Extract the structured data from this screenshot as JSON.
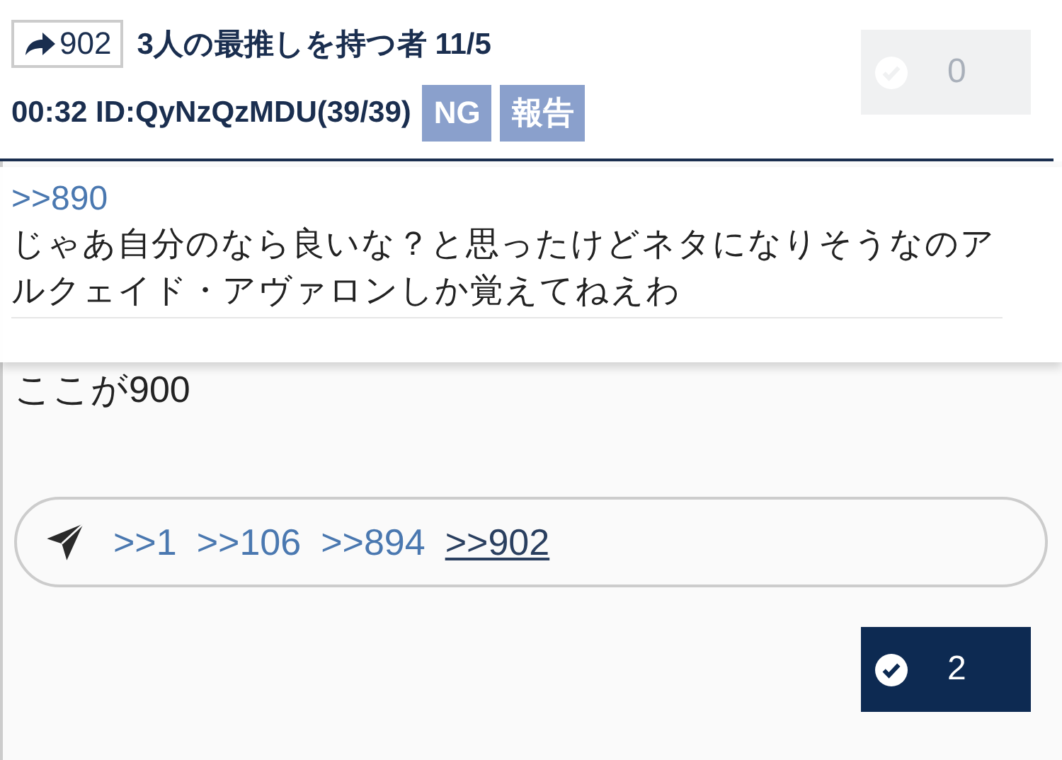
{
  "header": {
    "post_number": "902",
    "name": "3人の最推しを持つ者 11/5",
    "meta": "00:32 ID:QyNzQzMDU(39/39)",
    "tags": [
      "NG",
      "報告"
    ],
    "like": {
      "count": "0",
      "active": false
    }
  },
  "popup": {
    "anchor": ">>890",
    "text": "じゃあ自分のなら良いな？と思ったけどネタになりそうなのアルクェイド・アヴァロンしか覚えてねえわ"
  },
  "post": {
    "body": "ここが900",
    "replies": [
      {
        "label": ">>1",
        "selected": false
      },
      {
        "label": ">>106",
        "selected": false
      },
      {
        "label": ">>894",
        "selected": false
      },
      {
        "label": ">>902",
        "selected": true
      }
    ],
    "like": {
      "count": "2",
      "active": true
    }
  }
}
